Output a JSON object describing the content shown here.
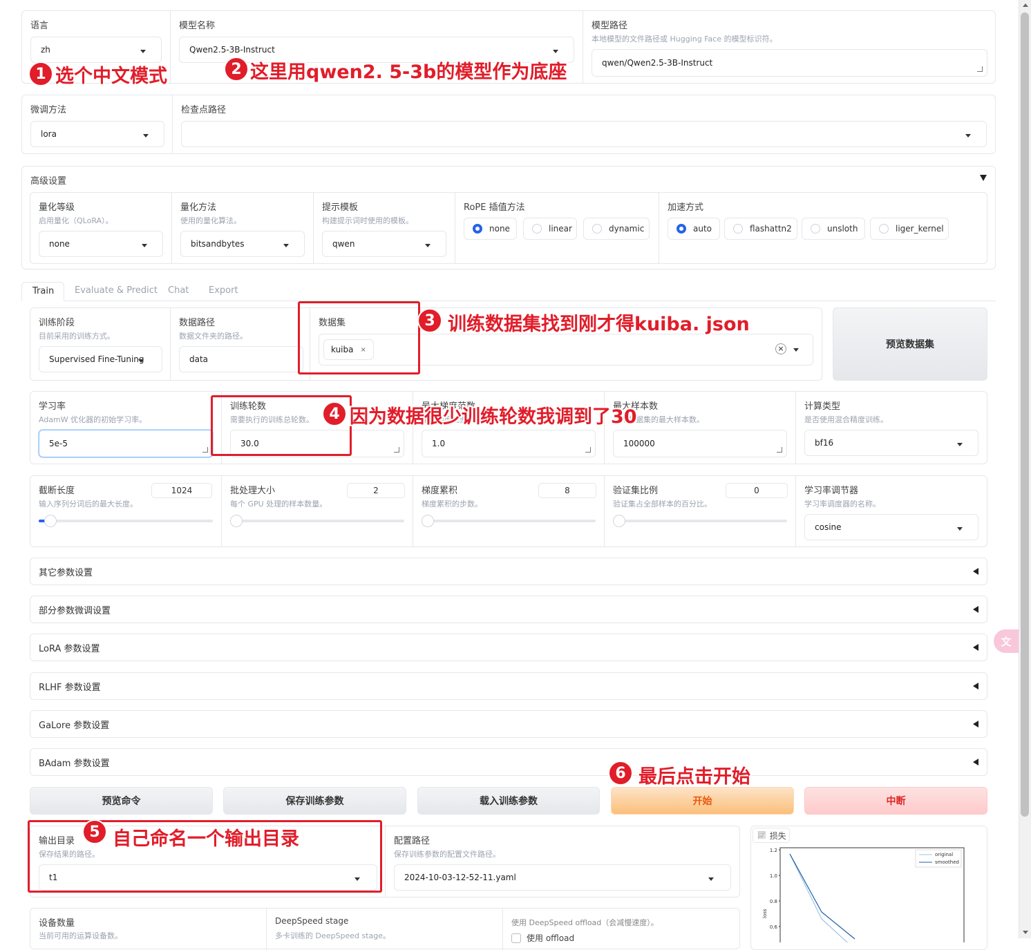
{
  "top": {
    "language": {
      "label": "语言",
      "value": "zh"
    },
    "model_name": {
      "label": "模型名称",
      "value": "Qwen2.5-3B-Instruct"
    },
    "model_path": {
      "label": "模型路径",
      "hint": "本地模型的文件路径或 Hugging Face 的模型标识符。",
      "value": "qwen/Qwen2.5-3B-Instruct"
    },
    "finetune_method": {
      "label": "微调方法",
      "value": "lora"
    },
    "checkpoint_path": {
      "label": "检查点路径",
      "value": ""
    }
  },
  "advanced": {
    "title": "高级设置",
    "quant_bit": {
      "label": "量化等级",
      "hint": "启用量化（QLoRA）。",
      "value": "none"
    },
    "quant_method": {
      "label": "量化方法",
      "hint": "使用的量化算法。",
      "value": "bitsandbytes"
    },
    "template": {
      "label": "提示模板",
      "hint": "构建提示词时使用的模板。",
      "value": "qwen"
    },
    "rope": {
      "label": "RoPE 插值方法",
      "options": [
        "none",
        "linear",
        "dynamic"
      ],
      "selected": "none"
    },
    "booster": {
      "label": "加速方式",
      "options": [
        "auto",
        "flashattn2",
        "unsloth",
        "liger_kernel"
      ],
      "selected": "auto"
    }
  },
  "tabs": [
    "Train",
    "Evaluate & Predict",
    "Chat",
    "Export"
  ],
  "train": {
    "stage": {
      "label": "训练阶段",
      "hint": "目前采用的训练方式。",
      "value": "Supervised Fine-Tuning"
    },
    "dataset_dir": {
      "label": "数据路径",
      "hint": "数据文件夹的路径。",
      "value": "data"
    },
    "dataset": {
      "label": "数据集",
      "chip": "kuiba",
      "chip_close": "×",
      "clear": "×"
    },
    "preview_dataset": "预览数据集",
    "learning_rate": {
      "label": "学习率",
      "hint": "AdamW 优化器的初始学习率。",
      "value": "5e-5"
    },
    "epochs": {
      "label": "训练轮数",
      "hint": "需要执行的训练总轮数。",
      "value": "30.0"
    },
    "max_grad_norm": {
      "label": "最大梯度范数",
      "hint": "用于梯度裁剪的范数。",
      "value": "1.0"
    },
    "max_samples": {
      "label": "最大样本数",
      "hint": "每个数据集的最大样本数。",
      "value": "100000"
    },
    "compute_type": {
      "label": "计算类型",
      "hint": "是否使用混合精度训练。",
      "value": "bf16"
    },
    "cutoff_len": {
      "label": "截断长度",
      "hint": "输入序列分词后的最大长度。",
      "value": "1024",
      "fraction": 0.03
    },
    "batch_size": {
      "label": "批处理大小",
      "hint": "每个 GPU 处理的样本数量。",
      "value": "2",
      "fraction": 0.0
    },
    "grad_accum": {
      "label": "梯度累积",
      "hint": "梯度累积的步数。",
      "value": "8",
      "fraction": 0.0
    },
    "val_size": {
      "label": "验证集比例",
      "hint": "验证集占全部样本的百分比。",
      "value": "0",
      "fraction": 0.0
    },
    "lr_scheduler": {
      "label": "学习率调节器",
      "hint": "学习率调度器的名称。",
      "value": "cosine"
    },
    "accordions": [
      "其它参数设置",
      "部分参数微调设置",
      "LoRA 参数设置",
      "RLHF 参数设置",
      "GaLore 参数设置",
      "BAdam 参数设置"
    ],
    "buttons": {
      "preview_cmd": "预览命令",
      "save_args": "保存训练参数",
      "load_args": "载入训练参数",
      "start": "开始",
      "abort": "中断"
    },
    "output_dir": {
      "label": "输出目录",
      "hint": "保存结果的路径。",
      "value": "t1"
    },
    "config_path": {
      "label": "配置路径",
      "hint": "保存训练参数的配置文件路径。",
      "value": "2024-10-03-12-52-11.yaml"
    },
    "device_count": {
      "label": "设备数量",
      "hint": "当前可用的运算设备数。"
    },
    "ds_stage": {
      "label": "DeepSpeed stage",
      "hint": "多卡训练的 DeepSpeed stage。"
    },
    "ds_offload": {
      "label": "使用 DeepSpeed offload（会减慢速度）。",
      "checkbox": "使用 offload"
    }
  },
  "loss_chart": {
    "tab": "损失",
    "ylabel": "loss",
    "ticks": [
      "1.2",
      "1.0",
      "0.8",
      "0.6"
    ],
    "legend": [
      "original",
      "smoothed"
    ]
  },
  "annotations": {
    "a1": {
      "num": "1",
      "text": "选个中文模式"
    },
    "a2": {
      "num": "2",
      "text": "这里用qwen2. 5-3b的模型作为底座"
    },
    "a3": {
      "num": "3",
      "text": "训练数据集找到刚才得kuiba. json"
    },
    "a4": {
      "num": "4",
      "text": "因为数据很少训练轮数我调到了30"
    },
    "a5": {
      "num": "5",
      "text": "自己命名一个输出目录"
    },
    "a6": {
      "num": "6",
      "text": "最后点击开始"
    }
  },
  "colors": {
    "accent": "#2563eb",
    "annotation_red": "#e11d2a",
    "start_orange": "#fbbf7a",
    "abort_pink": "#fecaca"
  }
}
